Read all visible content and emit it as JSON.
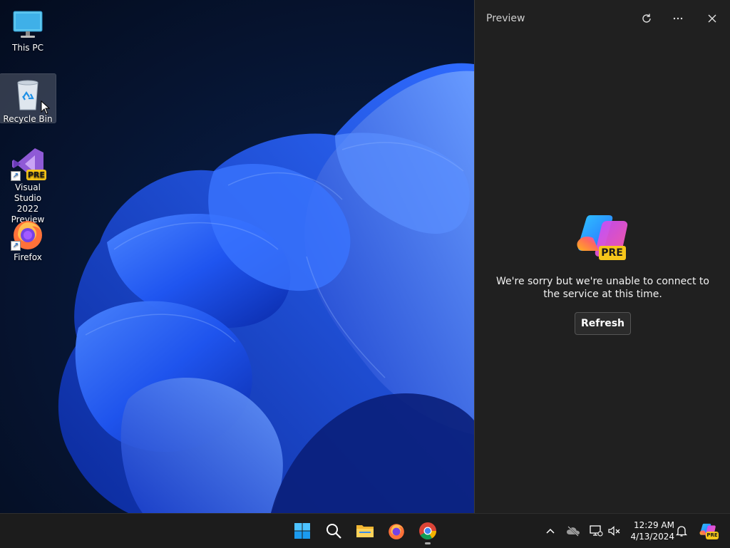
{
  "desktop": {
    "icons": [
      {
        "label": "This PC",
        "icon": "computer-icon"
      },
      {
        "label": "Recycle Bin",
        "icon": "recycle-bin-icon"
      },
      {
        "label": "Visual Studio 2022 Preview",
        "line1": "Visual Studio",
        "line2": "2022 Preview",
        "icon": "visual-studio-icon",
        "badge": "PRE"
      },
      {
        "label": "Firefox",
        "icon": "firefox-icon"
      }
    ]
  },
  "panel": {
    "title": "Preview",
    "logo_badge": "PRE",
    "message_line1": "We're sorry but we're unable to connect to",
    "message_line2": "the service at this time.",
    "refresh_label": "Refresh"
  },
  "taskbar": {
    "apps": [
      "start-icon",
      "search-icon",
      "file-explorer-icon",
      "firefox-icon",
      "chrome-icon"
    ],
    "tray": [
      "chevron-up-icon",
      "onedrive-offline-icon",
      "network-icon",
      "volume-muted-icon"
    ],
    "time": "12:29 AM",
    "date": "4/13/2024",
    "copilot_badge": "PRE"
  },
  "colors": {
    "panel_bg": "#202020",
    "taskbar_bg": "#1c1c1c",
    "badge_yellow": "#f6c61a",
    "bloom_blue": "#1e5bff"
  }
}
